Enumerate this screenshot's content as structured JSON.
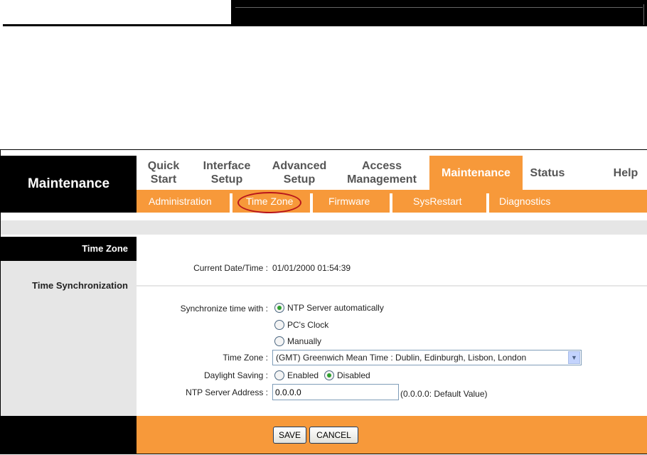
{
  "header": {
    "section_title": "Maintenance"
  },
  "nav": {
    "tabs": [
      {
        "label": "Quick Start"
      },
      {
        "label": "Interface Setup"
      },
      {
        "label": "Advanced Setup"
      },
      {
        "label": "Access Management"
      },
      {
        "label": "Maintenance",
        "active": true
      },
      {
        "label": "Status"
      },
      {
        "label": "Help"
      }
    ]
  },
  "subnav": {
    "items": [
      {
        "label": "Administration"
      },
      {
        "label": "Time Zone",
        "active": true
      },
      {
        "label": "Firmware"
      },
      {
        "label": "SysRestart"
      },
      {
        "label": "Diagnostics"
      }
    ]
  },
  "sidebar": {
    "section": "Time Zone",
    "subsection": "Time Synchronization"
  },
  "form": {
    "current_label": "Current Date/Time :",
    "current_value": "01/01/2000 01:54:39",
    "sync_label": "Synchronize time with :",
    "sync_options": [
      "NTP Server automatically",
      "PC's Clock",
      "Manually"
    ],
    "sync_selected": "NTP Server automatically",
    "tz_label": "Time Zone :",
    "tz_value": "(GMT) Greenwich Mean Time : Dublin, Edinburgh, Lisbon, London",
    "dst_label": "Daylight Saving :",
    "dst_options": [
      "Enabled",
      "Disabled"
    ],
    "dst_selected": "Disabled",
    "ntp_label": "NTP Server Address :",
    "ntp_value": "0.0.0.0",
    "ntp_hint": "(0.0.0.0: Default Value)"
  },
  "footer": {
    "save": "SAVE",
    "cancel": "CANCEL"
  },
  "colors": {
    "accent": "#f7993a",
    "highlight_circle": "#b8161c"
  }
}
